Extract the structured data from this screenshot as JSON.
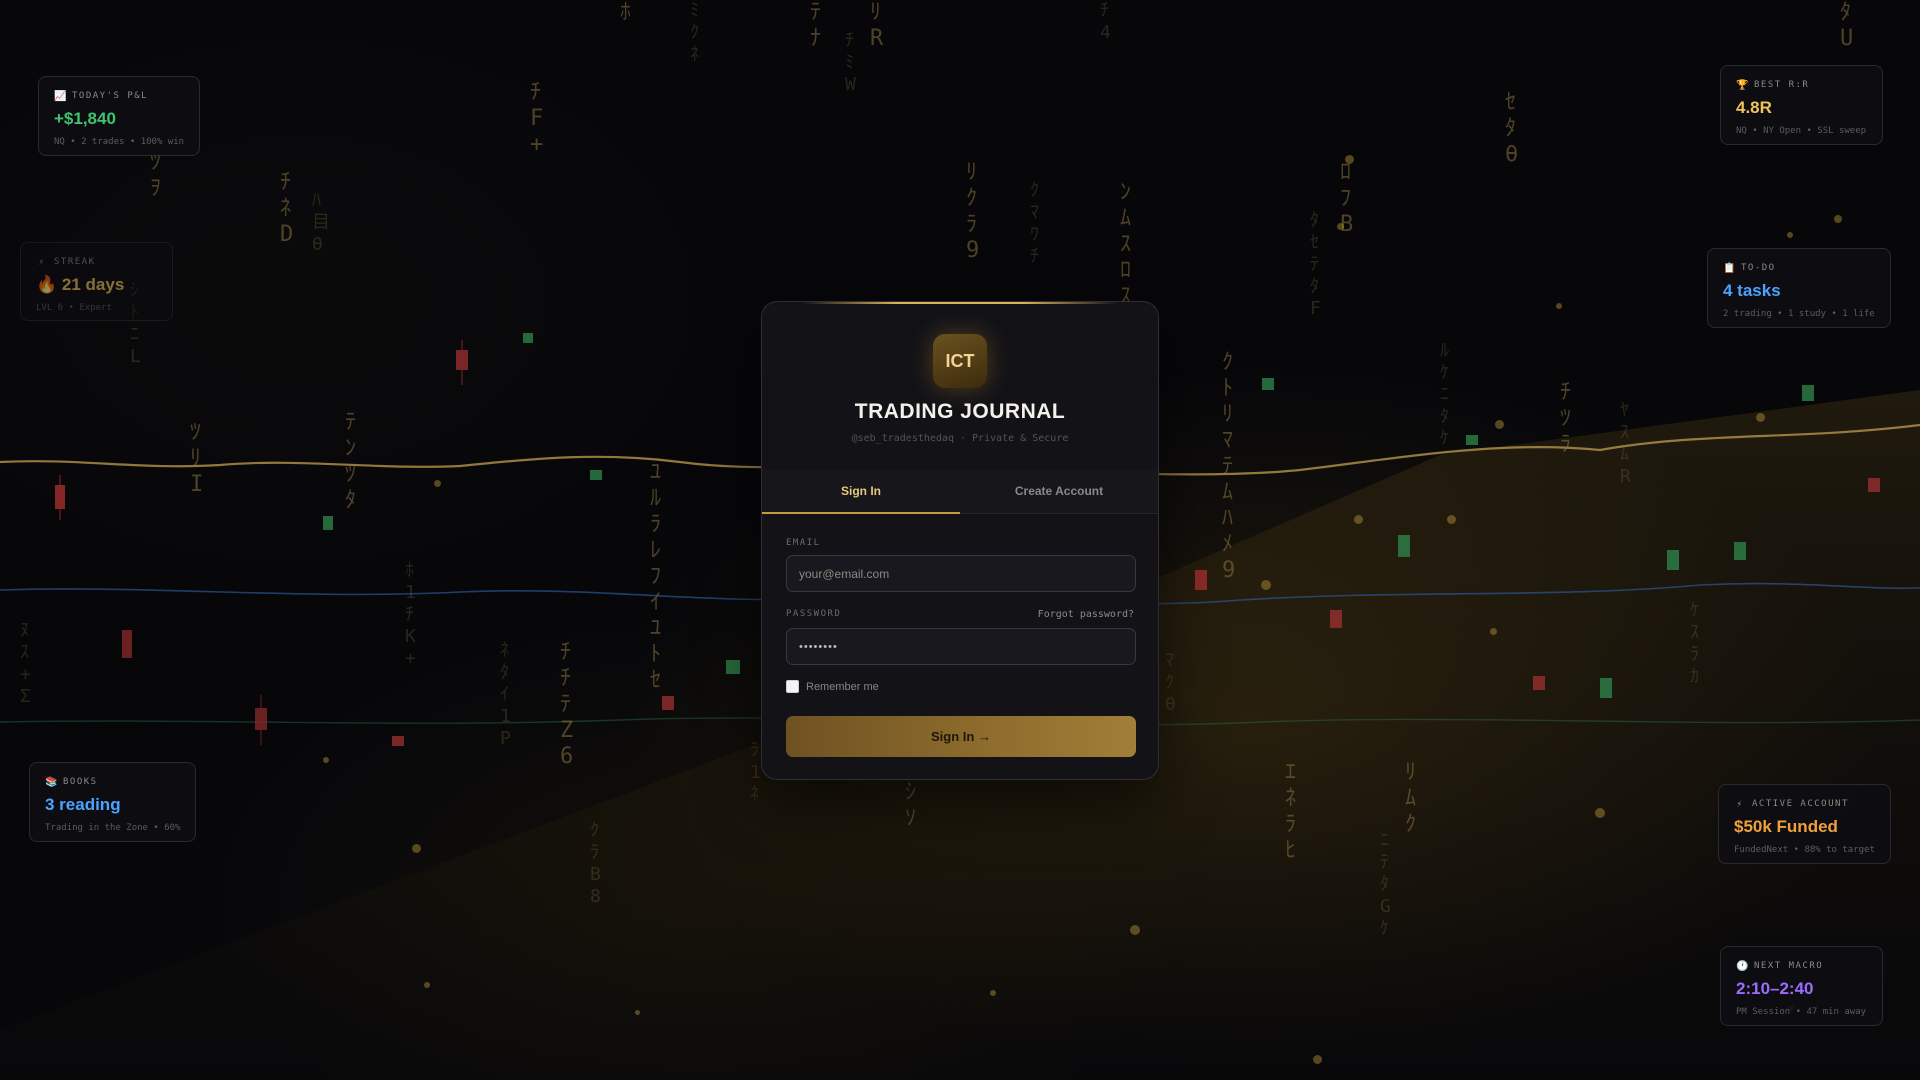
{
  "colors": {
    "accent_gold": "#d8b25a",
    "profit_green": "#3fc46f",
    "value_blue": "#4aa3ff",
    "value_orange": "#f2a03a",
    "value_purple": "#9b6cff",
    "value_gold": "#f0c45a"
  },
  "stats": {
    "pnl": {
      "icon": "chart-icon",
      "icon_glyph": "📈",
      "label": "TODAY'S P&L",
      "value": "+$1,840",
      "sub": "NQ • 2 trades • 100% win"
    },
    "streak": {
      "icon": "bolt-icon",
      "icon_glyph": "⚡",
      "label": "STREAK",
      "value": "🔥 21 days",
      "sub": "LVL 6 • Expert"
    },
    "books": {
      "icon": "books-icon",
      "icon_glyph": "📚",
      "label": "BOOKS",
      "value": "3 reading",
      "sub": "Trading in the Zone • 60%"
    },
    "best_rr": {
      "icon": "trophy-icon",
      "icon_glyph": "🏆",
      "label": "BEST R:R",
      "value": "4.8R",
      "sub": "NQ • NY Open • SSL sweep"
    },
    "todo": {
      "icon": "clipboard-icon",
      "icon_glyph": "📋",
      "label": "TO-DO",
      "value": "4 tasks",
      "sub": "2 trading • 1 study • 1 life"
    },
    "account": {
      "icon": "bolt-icon",
      "icon_glyph": "⚡",
      "label": "ACTIVE ACCOUNT",
      "value": "$50k Funded",
      "sub": "FundedNext • 88% to target"
    },
    "macro": {
      "icon": "clock-icon",
      "icon_glyph": "🕐",
      "label": "NEXT MACRO",
      "value": "2:10–2:40",
      "sub": "PM Session • 47 min away"
    }
  },
  "login": {
    "logo_text": "ICT",
    "title": "TRADING JOURNAL",
    "subtitle": "@seb_tradesthedaq · Private & Secure",
    "tabs": [
      "Sign In",
      "Create Account"
    ],
    "email_label": "EMAIL",
    "email_placeholder": "your@email.com",
    "password_label": "PASSWORD",
    "forgot_label": "Forgot password?",
    "password_value": "••••••••",
    "remember_label": "Remember me",
    "submit_label": "Sign In →"
  }
}
